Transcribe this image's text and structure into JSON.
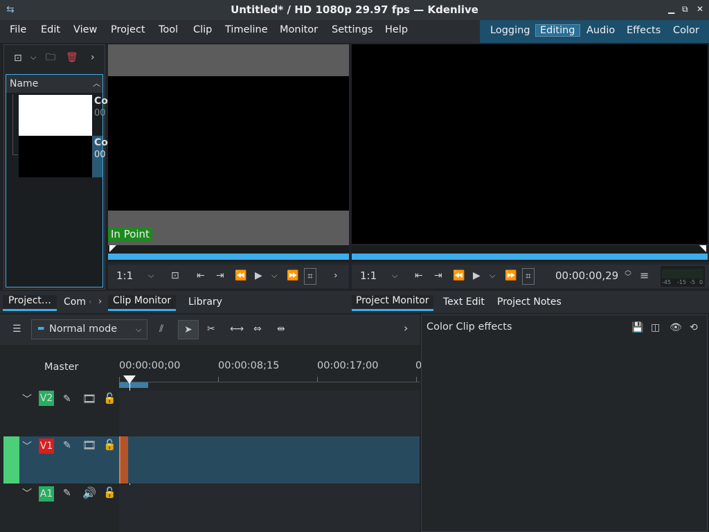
{
  "window": {
    "title": "Untitled* / HD 1080p 29.97 fps — Kdenlive"
  },
  "menu": [
    "File",
    "Edit",
    "View",
    "Project",
    "Tool",
    "Clip",
    "Timeline",
    "Monitor",
    "Settings",
    "Help"
  ],
  "layouts": {
    "items": [
      "Logging",
      "Editing",
      "Audio",
      "Effects",
      "Color"
    ],
    "active": "Editing"
  },
  "bin": {
    "header": "Name",
    "items": [
      {
        "name_fragment": "Co",
        "sub_fragment": "00"
      },
      {
        "name_fragment": "Co",
        "sub_fragment": "00"
      }
    ]
  },
  "clip_monitor": {
    "in_point_label": "In Point",
    "zoom": "1:1"
  },
  "project_monitor": {
    "zoom": "1:1",
    "timecode": "00:00:00,29",
    "vu_labels": [
      "-45",
      "-15",
      "-5",
      "0"
    ]
  },
  "left_tabs": [
    "Project…",
    "Com"
  ],
  "monitor_tabs": [
    "Clip Monitor",
    "Library"
  ],
  "right_tabs": [
    "Project Monitor",
    "Text Edit",
    "Project Notes"
  ],
  "timeline": {
    "mode": "Normal mode",
    "master": "Master",
    "ruler": [
      "00:00:00;00",
      "00:00:08;15",
      "00:00:17;00",
      "0"
    ],
    "tracks": [
      {
        "name": "V2",
        "color": "#27ae60"
      },
      {
        "name": "V1",
        "color": "#da1d1d"
      },
      {
        "name": "A1",
        "color": "#27ae60"
      }
    ]
  },
  "effects_panel": {
    "title": "Color Clip effects"
  },
  "colors": {
    "accent": "#3daee9",
    "selected_track": "#284a5e",
    "in_point": "#1e8a1e",
    "track_marker": "#4ccf78"
  }
}
